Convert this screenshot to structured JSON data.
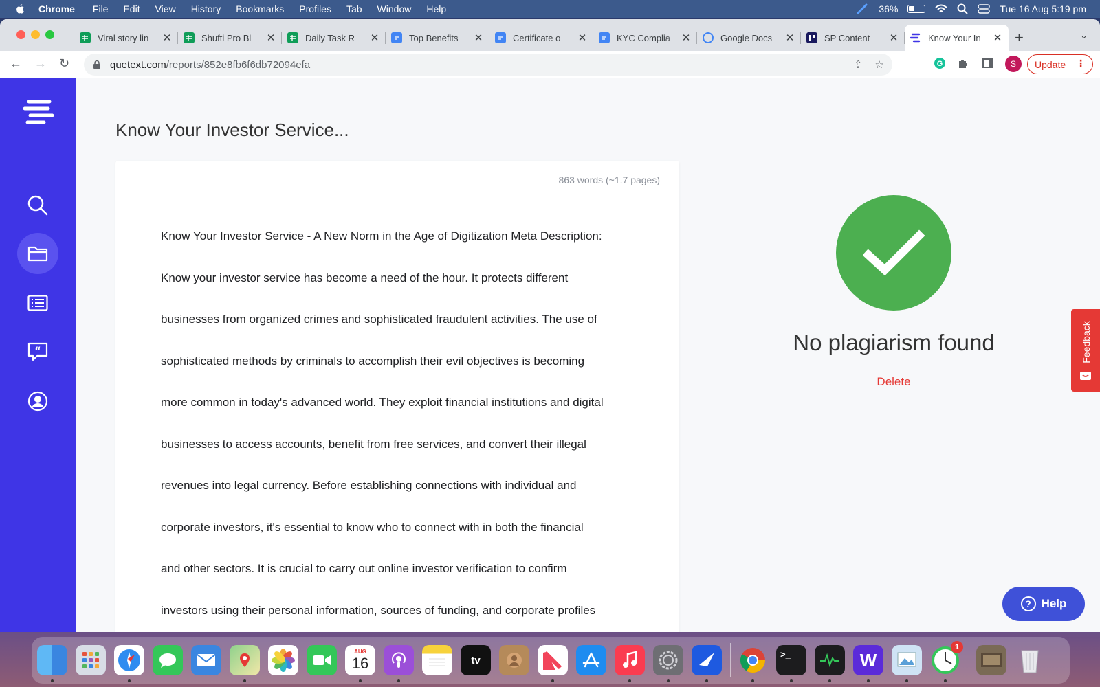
{
  "menubar": {
    "app": "Chrome",
    "items": [
      "File",
      "Edit",
      "View",
      "History",
      "Bookmarks",
      "Profiles",
      "Tab",
      "Window",
      "Help"
    ],
    "battery": "36%",
    "datetime": "Tue 16 Aug  5:19 pm"
  },
  "tabs": [
    {
      "title": "Viral story lin",
      "icon": "sheets-icon",
      "color": "#0f9d58"
    },
    {
      "title": "Shufti Pro Bl",
      "icon": "sheets-icon",
      "color": "#0f9d58"
    },
    {
      "title": "Daily Task R",
      "icon": "sheets-icon",
      "color": "#0f9d58"
    },
    {
      "title": "Top Benefits",
      "icon": "docs-icon",
      "color": "#4285f4"
    },
    {
      "title": "Certificate o",
      "icon": "docs-icon",
      "color": "#4285f4"
    },
    {
      "title": "KYC Complia",
      "icon": "docs-icon",
      "color": "#4285f4"
    },
    {
      "title": "Google Docs",
      "icon": "google-icon",
      "color": "#4285f4"
    },
    {
      "title": "SP Content",
      "icon": "trello-icon",
      "color": "#1a1a5e"
    },
    {
      "title": "Know Your In",
      "icon": "quetext-icon",
      "color": "#3f35e6",
      "active": true
    }
  ],
  "address": {
    "domain": "quetext.com",
    "path": "/reports/852e8fb6f6db72094efa"
  },
  "profile_initial": "S",
  "update_label": "Update",
  "document": {
    "title": "Know Your Investor Service...",
    "word_count": "863 words (~1.7 pages)",
    "lines": [
      "Know Your Investor Service - A New Norm in the Age of Digitization Meta Description:",
      "Know your investor service has become a need of the hour. It protects different",
      "businesses from organized crimes and sophisticated fraudulent activities. The use of",
      "sophisticated methods by criminals to accomplish their evil objectives is becoming",
      "more common in today's advanced world. They exploit financial institutions and digital",
      "businesses to access accounts, benefit from free services, and convert their illegal",
      "revenues into legal currency. Before establishing connections with individual and",
      "corporate investors, it's essential to know who to connect with in both the financial",
      "and other sectors. It is crucial to carry out online investor verification to confirm",
      "investors using their personal information, sources of funding, and corporate profiles"
    ]
  },
  "result": {
    "message": "No plagiarism found",
    "delete_label": "Delete",
    "status_color": "#4caf50"
  },
  "feedback_label": "Feedback",
  "help_label": "Help",
  "dock": {
    "apps": [
      "finder-icon",
      "launchpad-icon",
      "safari-icon",
      "messages-icon",
      "mail-icon",
      "maps-icon",
      "photos-icon",
      "facetime-icon",
      "calendar-icon",
      "podcasts-icon",
      "notes-icon",
      "tv-icon",
      "contacts-icon",
      "news-icon",
      "app-store-icon",
      "music-icon",
      "system-preferences-icon",
      "staff-timer-icon",
      "chrome-icon",
      "terminal-icon",
      "activity-monitor-icon",
      "webex-icon",
      "preview-icon",
      "clock-icon",
      "downloads-icon",
      "trash-icon"
    ],
    "calendar_month": "AUG",
    "calendar_day": "16",
    "clock_badge": "1"
  }
}
